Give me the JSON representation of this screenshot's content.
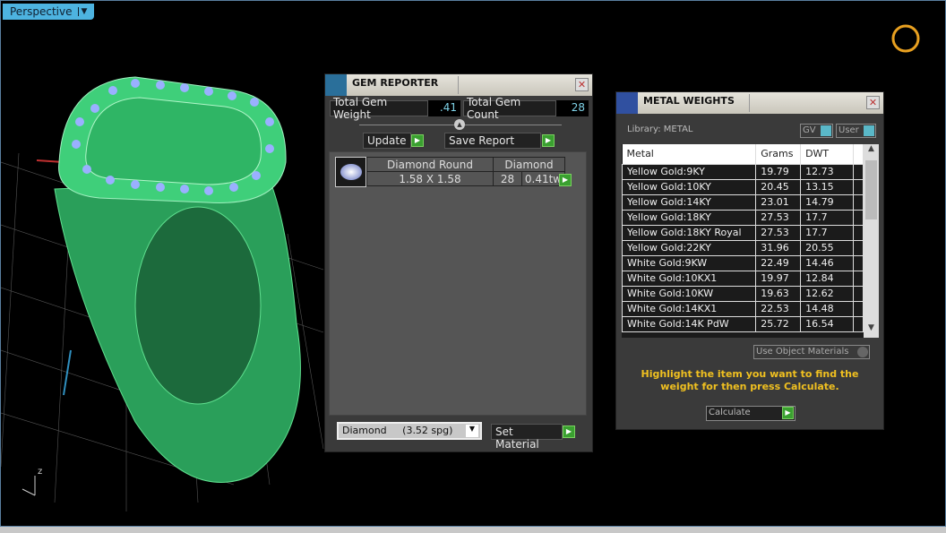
{
  "viewport": {
    "view_label": "Perspective",
    "axis_z": "z"
  },
  "gem_reporter": {
    "title": "GEM REPORTER",
    "total_weight_label": "Total Gem Weight",
    "total_weight": ".41",
    "total_count_label": "Total Gem Count",
    "total_count": "28",
    "update_label": "Update",
    "save_report_label": "Save Report",
    "gem": {
      "shape": "Diamond Round",
      "material": "Diamond",
      "size": "1.58 X 1.58",
      "count": "28",
      "weight": "0.41tw"
    },
    "material_select": "Diamond     (3.52 spg)",
    "set_material_label": "Set Material"
  },
  "metal_weights": {
    "title": "METAL WEIGHTS",
    "library": "Library: METAL",
    "gv_label": "GV",
    "user_label": "User",
    "columns": [
      "Metal",
      "Grams",
      "DWT"
    ],
    "rows": [
      [
        "Yellow Gold:9KY",
        "19.79",
        "12.73"
      ],
      [
        "Yellow Gold:10KY",
        "20.45",
        "13.15"
      ],
      [
        "Yellow Gold:14KY",
        "23.01",
        "14.79"
      ],
      [
        "Yellow Gold:18KY",
        "27.53",
        "17.7"
      ],
      [
        "Yellow Gold:18KY Royal",
        "27.53",
        "17.7"
      ],
      [
        "Yellow Gold:22KY",
        "31.96",
        "20.55"
      ],
      [
        "White Gold:9KW",
        "22.49",
        "14.46"
      ],
      [
        "White Gold:10KX1",
        "19.97",
        "12.84"
      ],
      [
        "White Gold:10KW",
        "19.63",
        "12.62"
      ],
      [
        "White Gold:14KX1",
        "22.53",
        "14.48"
      ],
      [
        "White Gold:14K PdW",
        "25.72",
        "16.54"
      ]
    ],
    "use_object_materials": "Use Object Materials",
    "hint": "Highlight the item you want to find the weight for then press Calculate.",
    "calculate_label": "Calculate"
  },
  "colors": {
    "ring": "#3fcf7a",
    "accent": "#4db3e0",
    "hint": "#f0c020"
  }
}
